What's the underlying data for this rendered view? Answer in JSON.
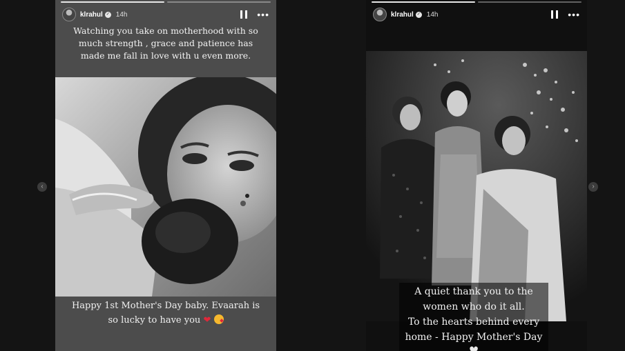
{
  "stories": [
    {
      "username": "klrahul",
      "time": "14h",
      "caption_top": "Watching you take on motherhood with so much strength , grace and patience has made me fall in love with u even more.",
      "caption_bottom": "Happy 1st Mother's Day baby. Evaarah is so lucky to have you",
      "emoji": [
        "red-heart",
        "face-blowing-kiss"
      ],
      "photo": "black-and-white photo of mother holding baby"
    },
    {
      "username": "klrahul",
      "time": "14h",
      "caption_lines": [
        "A quiet thank you to the",
        "women who do it all.",
        "To the hearts behind every",
        "home - Happy Mother's Day"
      ],
      "emoji": [
        "white-heart"
      ],
      "photo": "black-and-white photo of three women"
    }
  ],
  "icons": [
    "verified-badge-icon",
    "pause-icon",
    "more-options-icon",
    "chevron-left-icon",
    "chevron-right-icon"
  ],
  "colors": {
    "page_bg": "#141414",
    "heart": "#e0283a"
  }
}
